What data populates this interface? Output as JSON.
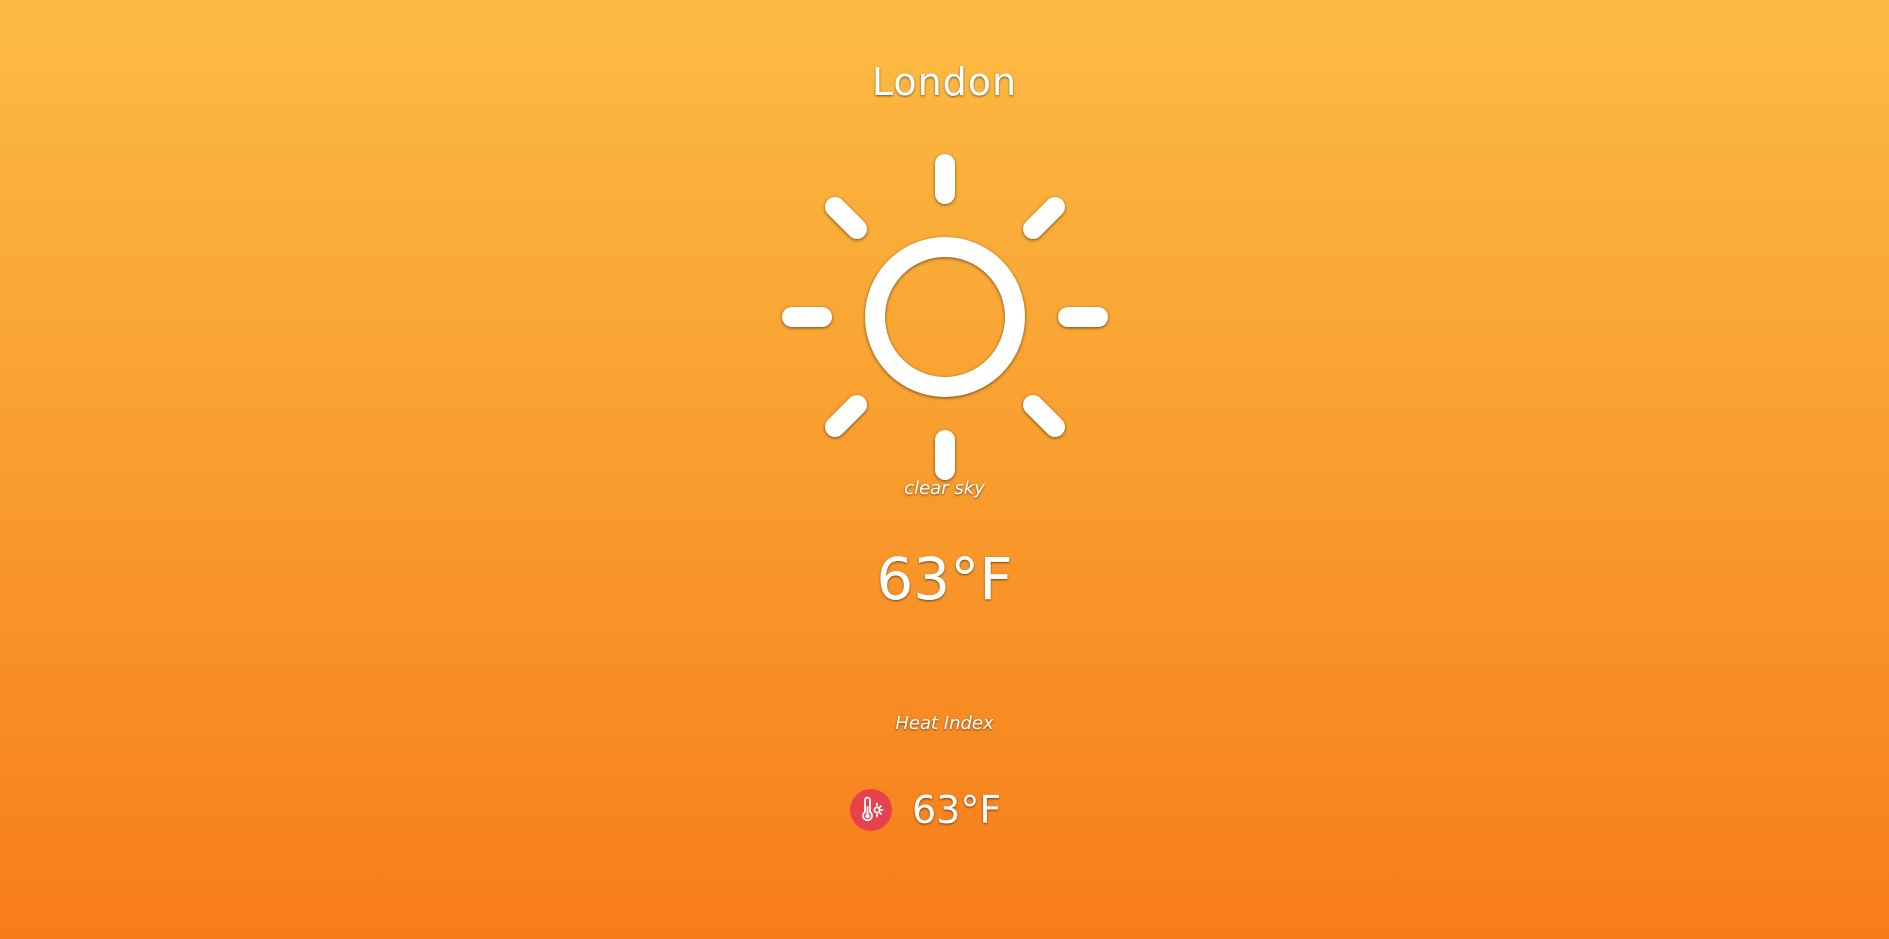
{
  "weather": {
    "city": "London",
    "icon": "sun-icon",
    "description": "clear sky",
    "temperature": "63°F"
  },
  "heat_index": {
    "label": "Heat Index",
    "icon": "thermometer-sun-icon",
    "value": "63°F"
  },
  "colors": {
    "gradient_top": "#fcbc43",
    "gradient_bottom": "#f87c1a",
    "heat_icon_bg": "#e8414e",
    "text": "#ffffff"
  }
}
